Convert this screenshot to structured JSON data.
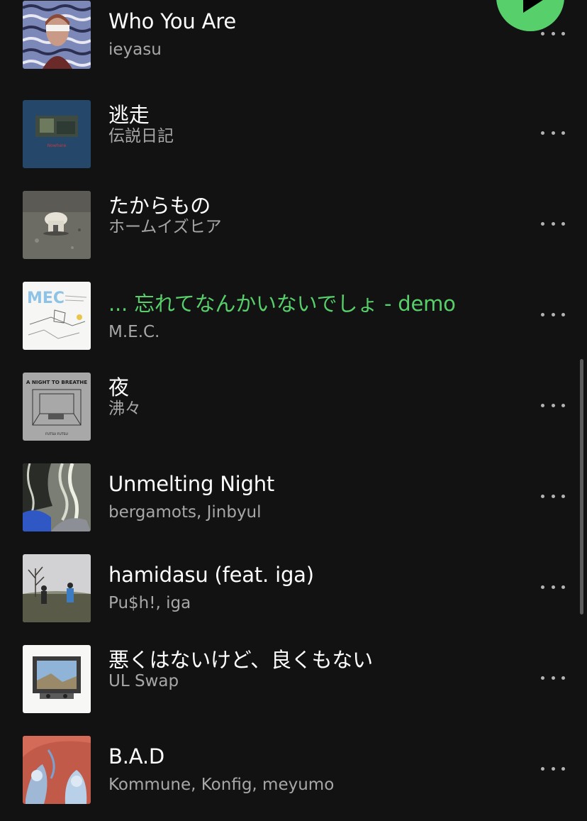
{
  "playlist": {
    "tracks": [
      {
        "title": "Who You Are",
        "artist": "ieyasu",
        "playing": false
      },
      {
        "title": "逃走",
        "artist": "伝説日記",
        "playing": false
      },
      {
        "title": "たからもの",
        "artist": "ホームイズヒア",
        "playing": false
      },
      {
        "title": "... 忘れてなんかいないでしょ - demo",
        "artist": "M.E.C.",
        "playing": true
      },
      {
        "title": "夜",
        "artist": "沸々",
        "playing": false
      },
      {
        "title": "Unmelting Night",
        "artist": "bergamots, Jinbyul",
        "playing": false
      },
      {
        "title": "hamidasu (feat. iga)",
        "artist": "Pu$h!, iga",
        "playing": false
      },
      {
        "title": "悪くはないけど、良くもない",
        "artist": "UL Swap",
        "playing": false
      },
      {
        "title": "B.A.D",
        "artist": "Kommune, Konfig, meyumo",
        "playing": false
      }
    ],
    "art_text": {
      "track_2": "Nowhere",
      "track_4": "MEC",
      "track_5_title": "A NIGHT TO BREATHE",
      "track_5_sub": "FUTSU FUTSU"
    }
  },
  "icons": {
    "play": "play-icon",
    "more": "more-options-icon"
  },
  "colors": {
    "background": "#121212",
    "accent": "#57cf6a",
    "primary_text": "#ffffff",
    "secondary_text": "#a7a7a7"
  }
}
